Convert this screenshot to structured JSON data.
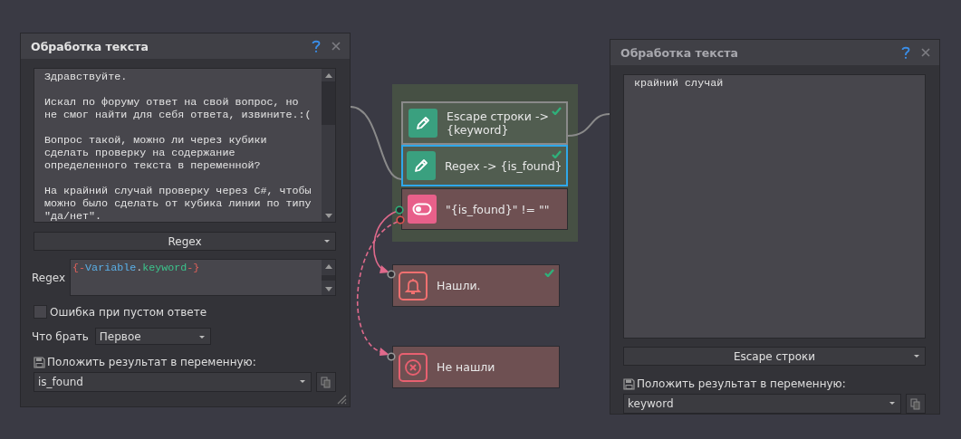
{
  "panels": [
    {
      "title": "Обработка текста",
      "text": "Здравствуйте.\n\nИскал по форуму ответ на свой вопрос, но\nне смог найти для себя ответа, извините.:(\n\nВопрос такой, можно ли через кубики\nсделать проверку на содержание\nопределенного текста в переменной?\n\nНа крайний случай проверку через C#, чтобы\nможно было сделать от кубика линии по типу\n\"да/нет\".",
      "mode": "Regex",
      "regex": {
        "label": "Regex",
        "parts": [
          {
            "text": "{-",
            "kind": "brace"
          },
          {
            "text": "Variable",
            "kind": "variable"
          },
          {
            "text": ".",
            "kind": "dot"
          },
          {
            "text": "keyword",
            "kind": "keyword"
          },
          {
            "text": "-}",
            "kind": "brace"
          }
        ]
      },
      "error_checkbox": {
        "label": "Ошибка при пустом ответе",
        "checked": false
      },
      "take": {
        "label": "Что брать",
        "value": "Первое"
      },
      "save_label": "Положить результат в переменную:",
      "variable": "is_found"
    },
    {
      "title": "Обработка текста",
      "text": "крайний случай",
      "mode": "Escape строки",
      "save_label": "Положить результат в переменную:",
      "variable": "keyword"
    }
  ],
  "nodes": [
    {
      "kind": "edit",
      "label": "Escape строки ->\n{keyword}",
      "done": true,
      "selected": false,
      "hovered": true
    },
    {
      "kind": "edit",
      "label": "Regex -> {is_found}",
      "done": true,
      "selected": true,
      "hovered": false
    },
    {
      "kind": "condition",
      "label": "\"{is_found}\" != \"\"",
      "done": false,
      "selected": false,
      "hovered": false
    },
    {
      "kind": "notify",
      "label": "Нашли.",
      "done": true,
      "selected": false,
      "hovered": false
    },
    {
      "kind": "stop",
      "label": "Не нашли",
      "done": false,
      "selected": false,
      "hovered": false
    }
  ]
}
